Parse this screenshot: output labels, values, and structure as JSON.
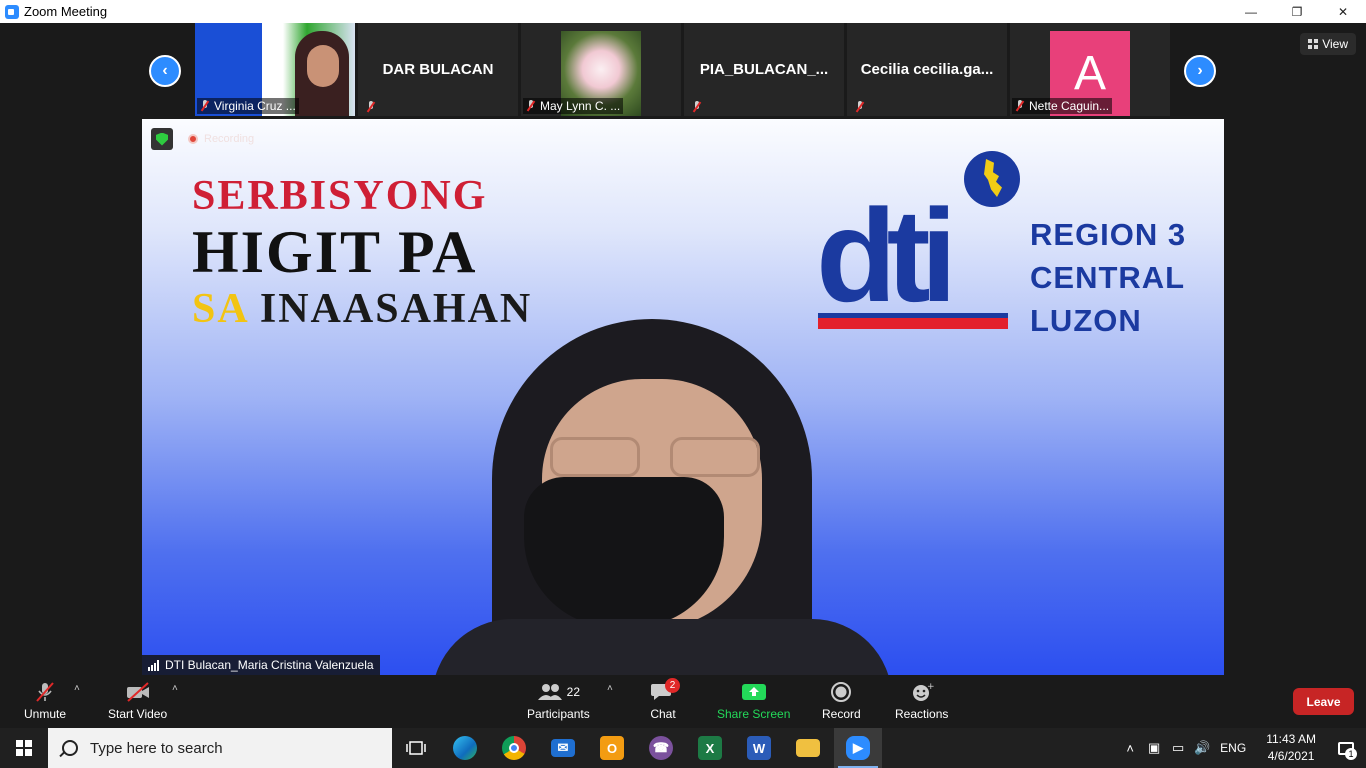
{
  "window": {
    "title": "Zoom Meeting",
    "controls": [
      "minimize",
      "restore",
      "close"
    ]
  },
  "participants_strip": {
    "tiles": [
      {
        "name": "Virginia Cruz ...",
        "muted": true,
        "has_video": true
      },
      {
        "name": "DAR BULACAN",
        "muted": true,
        "has_video": false
      },
      {
        "name": "May Lynn C. ...",
        "muted": true,
        "has_video": true
      },
      {
        "name": "PIA_BULACAN_...",
        "muted": true,
        "has_video": false
      },
      {
        "name": "Cecilia  cecilia.ga...",
        "muted": true,
        "has_video": false
      },
      {
        "name": "Nette Caguin...",
        "muted": true,
        "has_video": false,
        "avatar_letter": "A",
        "avatar_color": "#e8407a"
      }
    ],
    "view_label": "View"
  },
  "main_video": {
    "recording_label": "Recording",
    "speaker_name": "DTI Bulacan_Maria Cristina Valenzuela",
    "background": {
      "slogan_line1": "SERBISYONG",
      "slogan_line2": "HIGIT PA",
      "slogan_line3_highlight": "SA",
      "slogan_line3_rest": "INAASAHAN",
      "logo_text": "dti",
      "region_line1": "REGION 3",
      "region_line2": "CENTRAL",
      "region_line3": "LUZON"
    }
  },
  "toolbar": {
    "unmute_label": "Unmute",
    "start_video_label": "Start Video",
    "participants_label": "Participants",
    "participants_count": "22",
    "chat_label": "Chat",
    "chat_badge": "2",
    "share_screen_label": "Share Screen",
    "record_label": "Record",
    "reactions_label": "Reactions",
    "leave_label": "Leave"
  },
  "taskbar": {
    "search_placeholder": "Type here to search",
    "pinned_apps": [
      "task-view",
      "edge",
      "chrome",
      "mail",
      "outlook",
      "viber",
      "excel",
      "word",
      "file-explorer",
      "zoom"
    ],
    "language": "ENG",
    "time": "11:43 AM",
    "date": "4/6/2021",
    "notification_count": "1"
  },
  "colors": {
    "zoom_blue": "#2d8cff",
    "leave_red": "#c72525",
    "share_green": "#23d959",
    "dti_blue": "#1b3aa0",
    "dti_red": "#e3202c"
  }
}
